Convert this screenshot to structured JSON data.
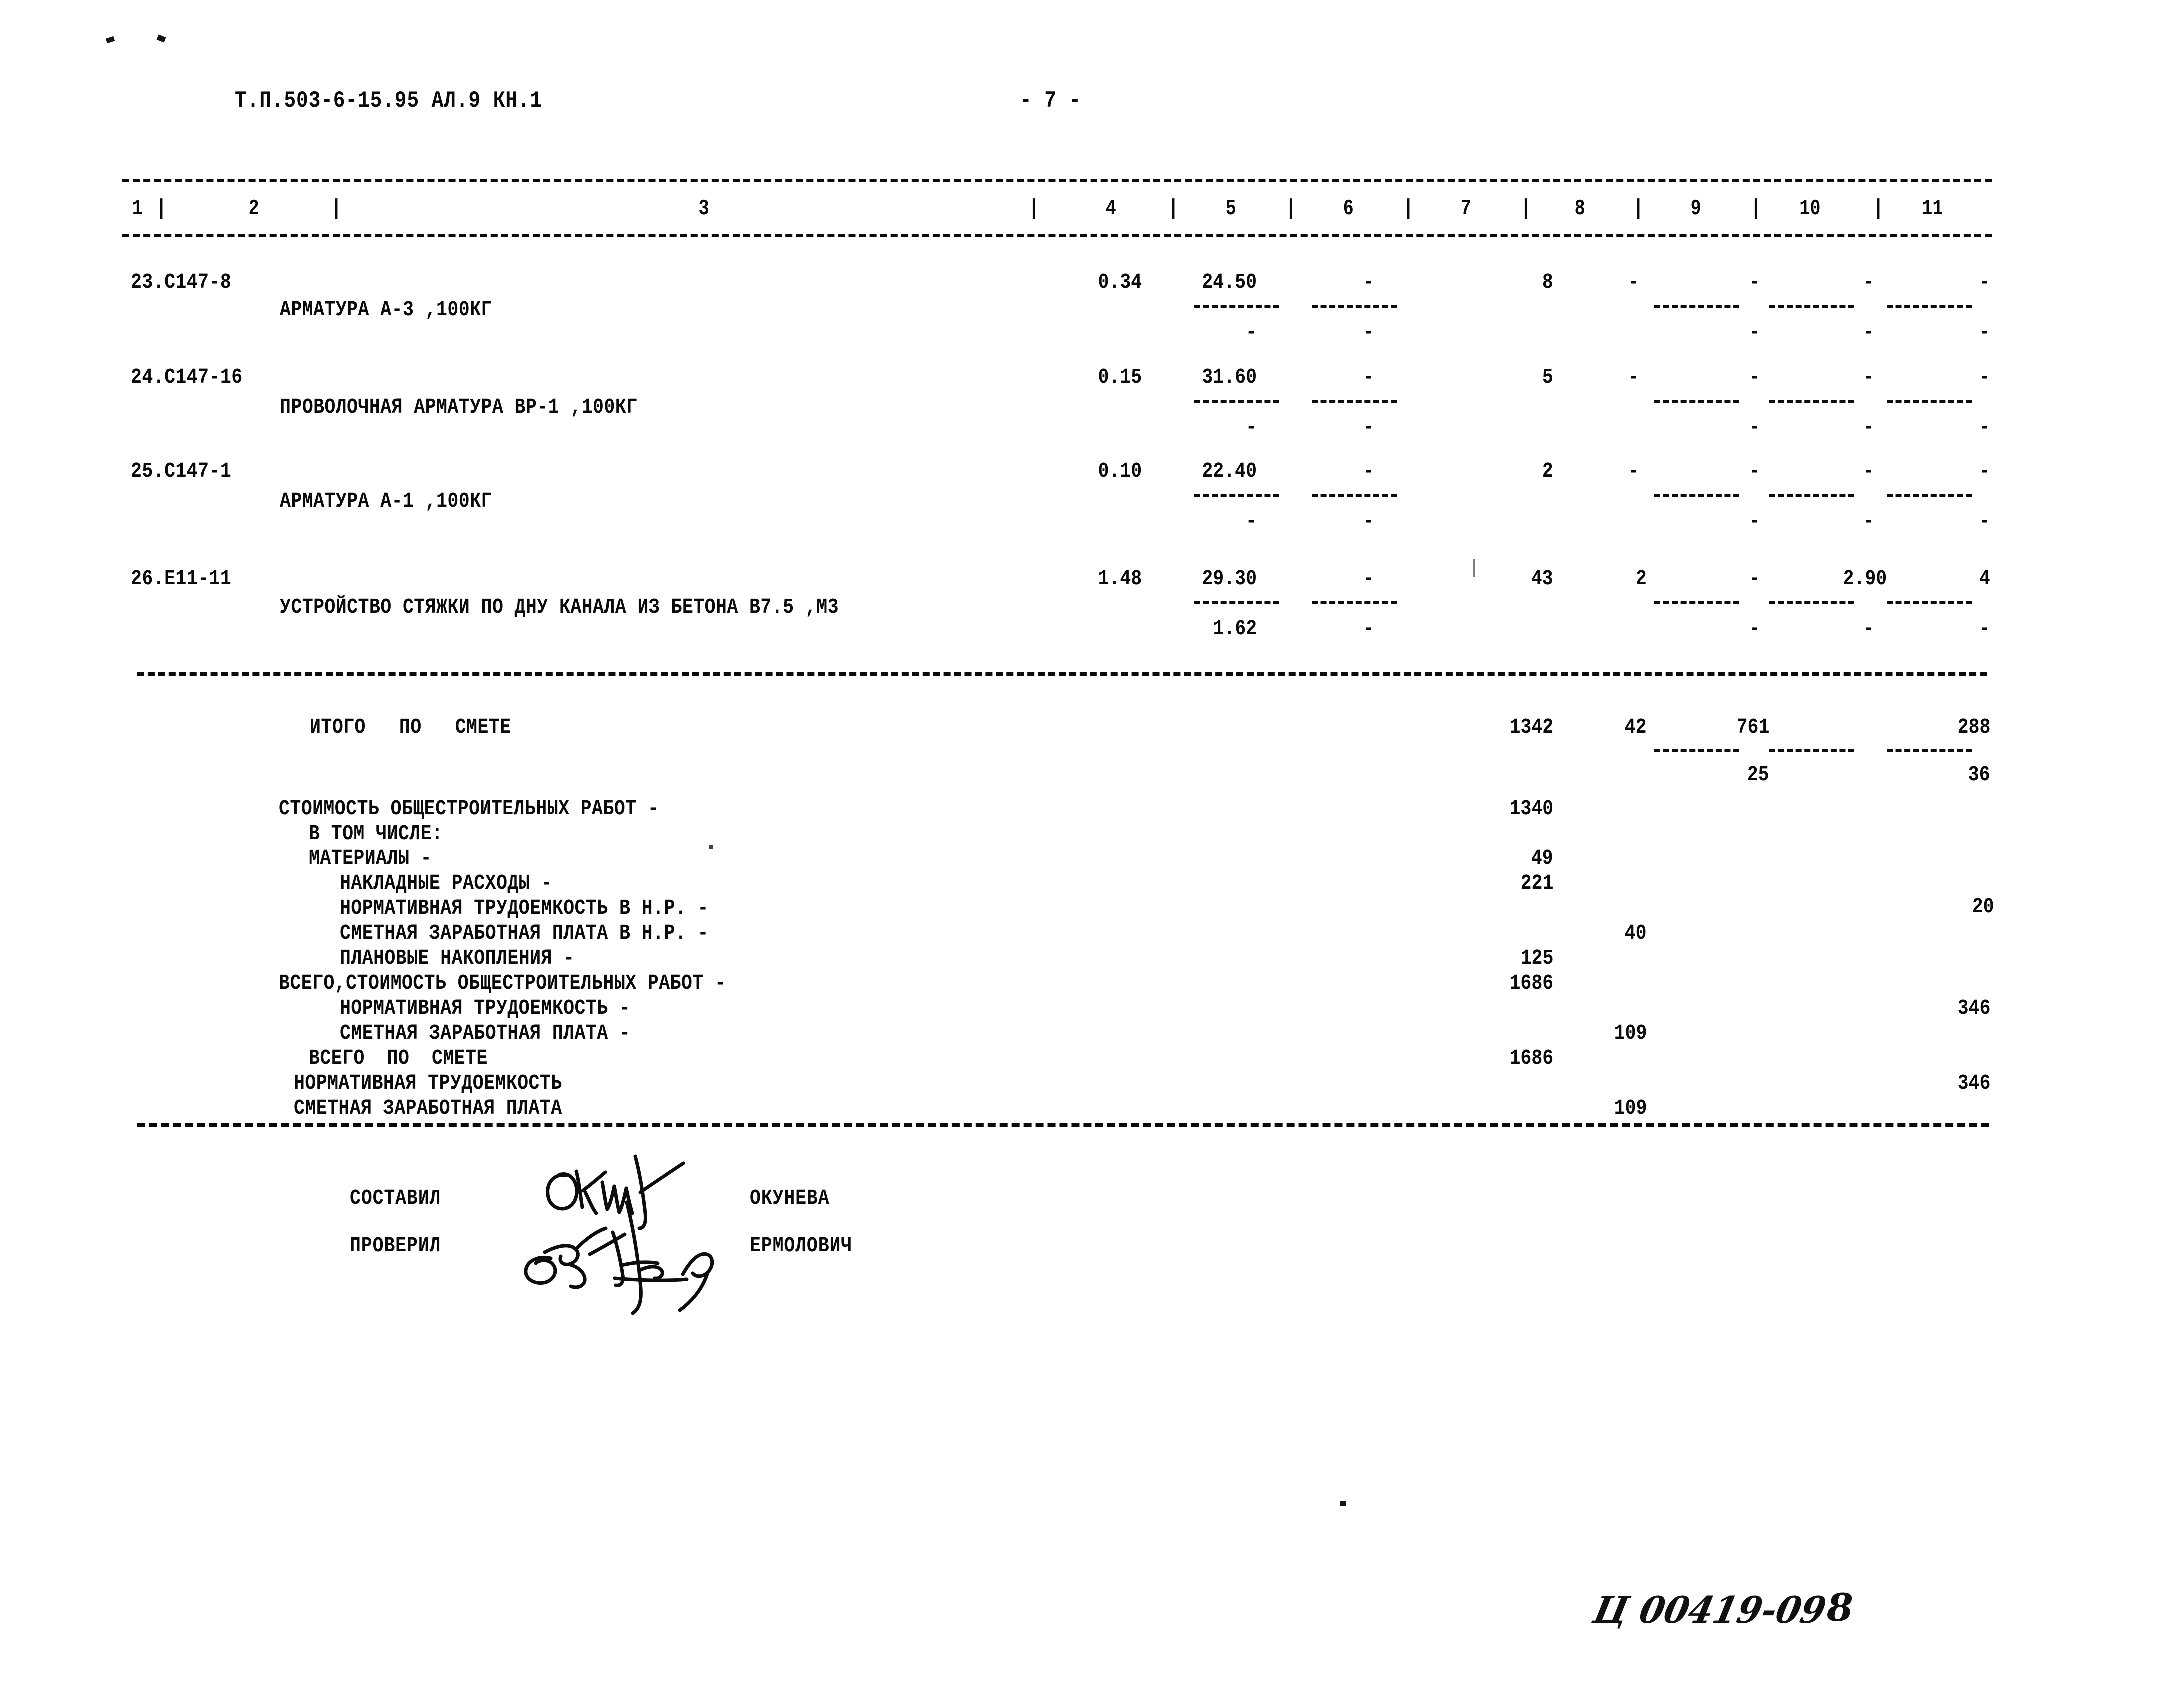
{
  "header": {
    "doc_code": "Т.П.503-6-15.95 АЛ.9 КН.1",
    "page_marker": "- 7 -"
  },
  "table": {
    "column_headers": [
      "1",
      "2",
      "3",
      "4",
      "5",
      "6",
      "7",
      "8",
      "9",
      "10",
      "11"
    ],
    "rows": [
      {
        "code": "23.С147-8",
        "description": "АРМАТУРА А-3 ,100КГ",
        "c4": "0.34",
        "c5": "24.50",
        "c6": "-",
        "c7": "8",
        "c8": "-",
        "c9": "-",
        "c10": "-",
        "c11": "-",
        "sub_c5": "-",
        "sub_c6": "-",
        "sub_c9": "-",
        "sub_c10": "-",
        "sub_c11": "-"
      },
      {
        "code": "24.С147-16",
        "description": "ПРОВОЛОЧНАЯ АРМАТУРА ВР-1 ,100КГ",
        "c4": "0.15",
        "c5": "31.60",
        "c6": "-",
        "c7": "5",
        "c8": "-",
        "c9": "-",
        "c10": "-",
        "c11": "-",
        "sub_c5": "-",
        "sub_c6": "-",
        "sub_c9": "-",
        "sub_c10": "-",
        "sub_c11": "-"
      },
      {
        "code": "25.С147-1",
        "description": "АРМАТУРА А-1 ,100КГ",
        "c4": "0.10",
        "c5": "22.40",
        "c6": "-",
        "c7": "2",
        "c8": "-",
        "c9": "-",
        "c10": "-",
        "c11": "-",
        "sub_c5": "-",
        "sub_c6": "-",
        "sub_c9": "-",
        "sub_c10": "-",
        "sub_c11": "-"
      },
      {
        "code": "26.Е11-11",
        "description": "УСТРОЙСТВО СТЯЖКИ ПО ДНУ КАНАЛА ИЗ БЕТОНА В7.5 ,М3",
        "c4": "1.48",
        "c5": "29.30",
        "c6": "-",
        "c7": "43",
        "c8": "2",
        "c9": "-",
        "c10": "2.90",
        "c11": "4",
        "sub_c5": "1.62",
        "sub_c6": "-",
        "sub_c9": "-",
        "sub_c10": "-",
        "sub_c11": "-"
      }
    ]
  },
  "summary": {
    "total_label": "ИТОГО   ПО   СМЕТЕ",
    "total_c7": "1342",
    "total_c8": "42",
    "total_c9": "761",
    "total_c11": "288",
    "total_sub_c9": "25",
    "total_sub_c11": "36",
    "lines": [
      {
        "label": "СТОИМОСТЬ ОБЩЕСТРОИТЕЛЬНЫХ РАБОТ -",
        "c7": "1340",
        "c8": "",
        "c11": ""
      },
      {
        "label": "В ТОМ ЧИСЛЕ:",
        "c7": "",
        "c8": "",
        "c11": ""
      },
      {
        "label": "МАТЕРИАЛЫ -",
        "c7": "49",
        "c8": "",
        "c11": ""
      },
      {
        "label": "НАКЛАДНЫЕ РАСХОДЫ -",
        "c7": "221",
        "c8": "",
        "c11": ""
      },
      {
        "label": "НОРМАТИВНАЯ ТРУДОЕМКОСТЬ В Н.Р. -",
        "c7": "",
        "c8": "",
        "c11": "20"
      },
      {
        "label": "СМЕТНАЯ ЗАРАБОТНАЯ ПЛАТА В Н.Р. -",
        "c7": "",
        "c8": "40",
        "c11": ""
      },
      {
        "label": "ПЛАНОВЫЕ НАКОПЛЕНИЯ -",
        "c7": "125",
        "c8": "",
        "c11": ""
      },
      {
        "label": "ВСЕГО,СТОИМОСТЬ ОБЩЕСТРОИТЕЛЬНЫХ РАБОТ -",
        "c7": "1686",
        "c8": "",
        "c11": ""
      },
      {
        "label": "НОРМАТИВНАЯ ТРУДОЕМКОСТЬ -",
        "c7": "",
        "c8": "",
        "c11": "346"
      },
      {
        "label": "СМЕТНАЯ ЗАРАБОТНАЯ ПЛАТА -",
        "c7": "",
        "c8": "109",
        "c11": ""
      },
      {
        "label": "ВСЕГО  ПО  СМЕТЕ",
        "c7": "1686",
        "c8": "",
        "c11": ""
      },
      {
        "label": "НОРМАТИВНАЯ ТРУДОЕМКОСТЬ",
        "c7": "",
        "c8": "",
        "c11": "346"
      },
      {
        "label": "СМЕТНАЯ ЗАРАБОТНАЯ ПЛАТА",
        "c7": "",
        "c8": "109",
        "c11": ""
      }
    ]
  },
  "signatures": {
    "compiled_by_label": "СОСТАВИЛ",
    "compiled_by_name": "ОКУНЕВА",
    "checked_by_label": "ПРОВЕРИЛ",
    "checked_by_name": "ЕРМОЛОВИЧ"
  },
  "archive_mark": {
    "code": "Ц 00419-09",
    "page": "8"
  },
  "colors": {
    "ink": "#0a0a0a",
    "paper": "#ffffff"
  }
}
